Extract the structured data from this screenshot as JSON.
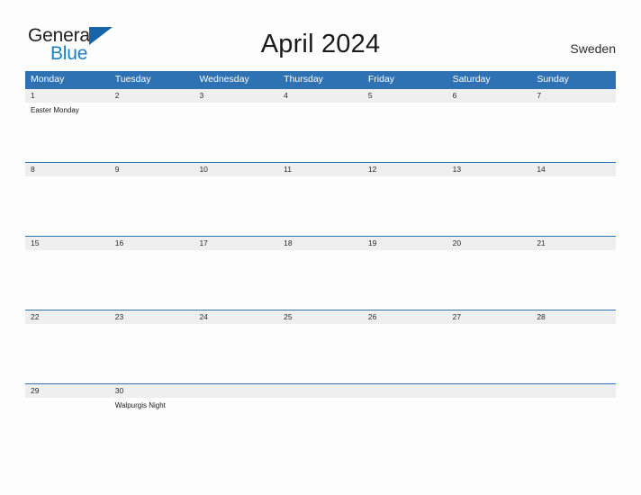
{
  "brand": {
    "name_part1": "General",
    "name_part2": "Blue",
    "flag_icon": "triangle-flag-icon",
    "accent_color": "#1d7fc4",
    "dark_color": "#231f20"
  },
  "header": {
    "title": "April 2024",
    "country": "Sweden"
  },
  "calendar": {
    "header_color": "#2e72b3",
    "band_color": "#efefef",
    "weekdays": [
      "Monday",
      "Tuesday",
      "Wednesday",
      "Thursday",
      "Friday",
      "Saturday",
      "Sunday"
    ],
    "weeks": [
      {
        "days": [
          {
            "date": "1",
            "event": "Easter Monday"
          },
          {
            "date": "2",
            "event": ""
          },
          {
            "date": "3",
            "event": ""
          },
          {
            "date": "4",
            "event": ""
          },
          {
            "date": "5",
            "event": ""
          },
          {
            "date": "6",
            "event": ""
          },
          {
            "date": "7",
            "event": ""
          }
        ]
      },
      {
        "days": [
          {
            "date": "8",
            "event": ""
          },
          {
            "date": "9",
            "event": ""
          },
          {
            "date": "10",
            "event": ""
          },
          {
            "date": "11",
            "event": ""
          },
          {
            "date": "12",
            "event": ""
          },
          {
            "date": "13",
            "event": ""
          },
          {
            "date": "14",
            "event": ""
          }
        ]
      },
      {
        "days": [
          {
            "date": "15",
            "event": ""
          },
          {
            "date": "16",
            "event": ""
          },
          {
            "date": "17",
            "event": ""
          },
          {
            "date": "18",
            "event": ""
          },
          {
            "date": "19",
            "event": ""
          },
          {
            "date": "20",
            "event": ""
          },
          {
            "date": "21",
            "event": ""
          }
        ]
      },
      {
        "days": [
          {
            "date": "22",
            "event": ""
          },
          {
            "date": "23",
            "event": ""
          },
          {
            "date": "24",
            "event": ""
          },
          {
            "date": "25",
            "event": ""
          },
          {
            "date": "26",
            "event": ""
          },
          {
            "date": "27",
            "event": ""
          },
          {
            "date": "28",
            "event": ""
          }
        ]
      },
      {
        "days": [
          {
            "date": "29",
            "event": ""
          },
          {
            "date": "30",
            "event": "Walpurgis Night"
          },
          {
            "date": "",
            "event": ""
          },
          {
            "date": "",
            "event": ""
          },
          {
            "date": "",
            "event": ""
          },
          {
            "date": "",
            "event": ""
          },
          {
            "date": "",
            "event": ""
          }
        ]
      }
    ]
  }
}
